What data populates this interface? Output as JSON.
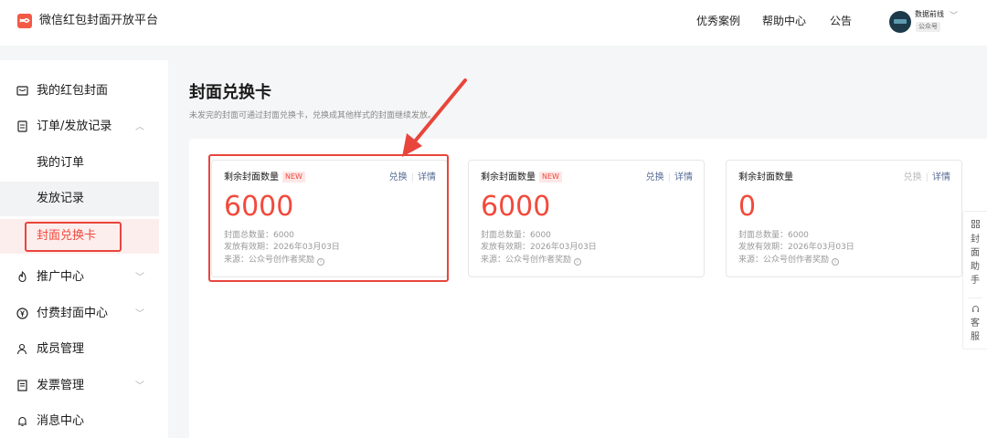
{
  "header": {
    "brand": "微信红包封面开放平台",
    "nav": [
      "优秀案例",
      "帮助中心",
      "公告"
    ],
    "account_name": "数据前线",
    "account_type": "公众号"
  },
  "sidebar": {
    "items": [
      {
        "label": "我的红包封面",
        "icon": "envelope-icon"
      },
      {
        "label": "订单/发放记录",
        "icon": "document-icon",
        "chevron": "︿"
      },
      {
        "label": "我的订单"
      },
      {
        "label": "发放记录"
      },
      {
        "label": "封面兑换卡"
      },
      {
        "label": "推广中心",
        "icon": "promote-icon",
        "chevron": "﹀"
      },
      {
        "label": "付费封面中心",
        "icon": "yen-icon",
        "chevron": "﹀"
      },
      {
        "label": "成员管理",
        "icon": "members-icon"
      },
      {
        "label": "发票管理",
        "icon": "invoice-icon",
        "chevron": "﹀"
      },
      {
        "label": "消息中心",
        "icon": "bell-icon"
      }
    ]
  },
  "main": {
    "title": "封面兑换卡",
    "description": "未发完的封面可通过封面兑换卡，兑换成其他样式的封面继续发放。",
    "cards": [
      {
        "key": "剩余封面数量",
        "badge": "NEW",
        "action_1": "兑换",
        "action_2": "详情",
        "action_1_disabled": false,
        "value": "6000",
        "total": "封面总数量：6000",
        "expiry": "发放有效期：2026年03月03日",
        "source": "来源：公众号创作者奖励"
      },
      {
        "key": "剩余封面数量",
        "badge": "NEW",
        "action_1": "兑换",
        "action_2": "详情",
        "action_1_disabled": false,
        "value": "6000",
        "total": "封面总数量：6000",
        "expiry": "发放有效期：2026年03月03日",
        "source": "来源：公众号创作者奖励"
      },
      {
        "key": "剩余封面数量",
        "badge": "",
        "action_1": "兑换",
        "action_2": "详情",
        "action_1_disabled": true,
        "value": "0",
        "total": "封面总数量：6000",
        "expiry": "发放有效期：2026年03月03日",
        "source": "来源：公众号创作者奖励"
      }
    ]
  },
  "float_helper": {
    "cover_helper": [
      "封",
      "面",
      "助",
      "手"
    ],
    "service": [
      "客",
      "服"
    ]
  },
  "colors": {
    "accent": "#f24a3c",
    "link": "#576b95",
    "annotation": "#e8453c"
  }
}
